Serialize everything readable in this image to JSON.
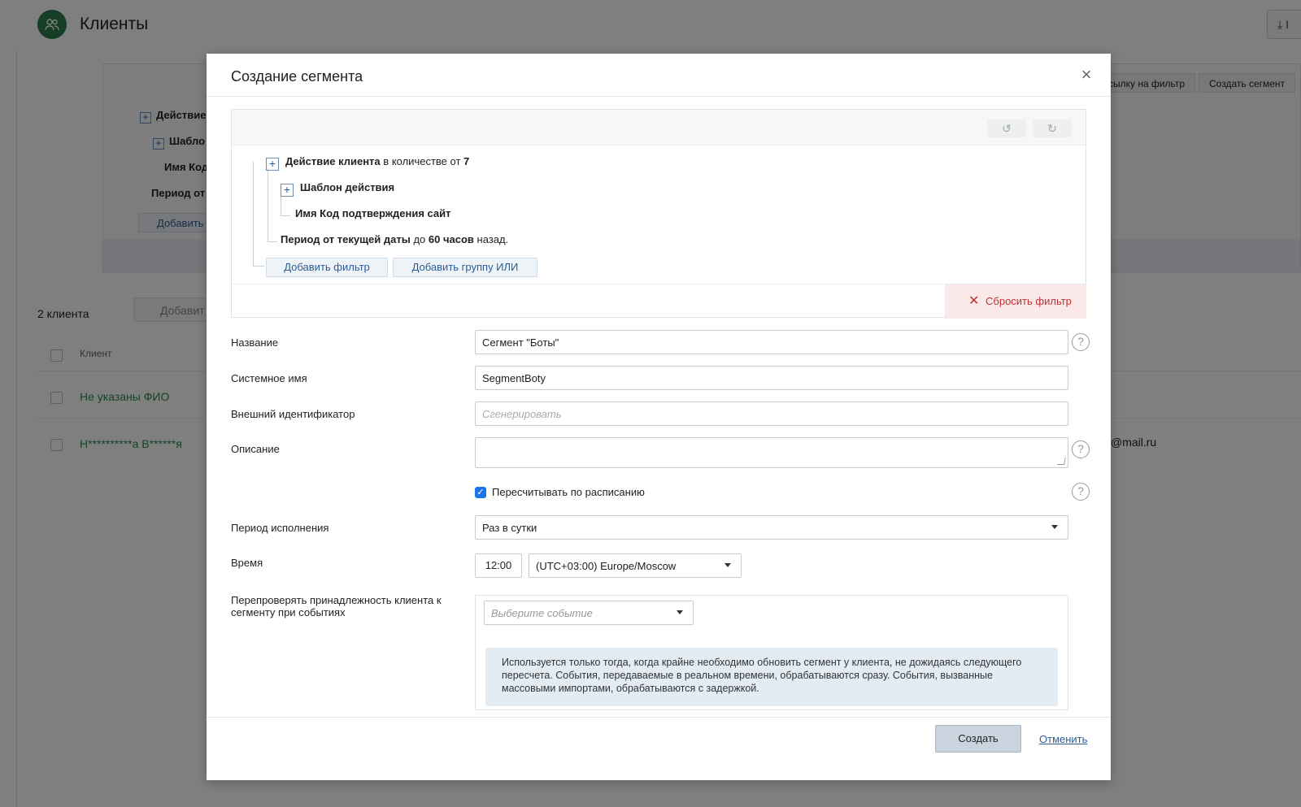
{
  "background": {
    "page_title": "Клиенты",
    "download_label": "⤓ I",
    "tree": {
      "action": "Действие",
      "template": "Шабло",
      "name": "Имя Код",
      "period": "Период от",
      "add_button": "Добавить"
    },
    "top_buttons": [
      "сылку на фильтр",
      "Создать сегмент"
    ],
    "client_count": "2 клиента",
    "add_small": "Добавит",
    "column_client": "Клиент",
    "rows": [
      {
        "name": "Не указаны ФИО"
      },
      {
        "name": "Н**********а В******я",
        "email": "@mail.ru"
      }
    ]
  },
  "modal": {
    "title": "Создание сегмента",
    "close_symbol": "×",
    "filter": {
      "undo_symbol": "↺",
      "redo_symbol": "↻",
      "action_bold": "Действие клиента",
      "action_rest": "в количестве от",
      "action_count": "7",
      "template_label": "Шаблон действия",
      "name_label": "Имя Код подтверждения сайт",
      "period_bold": "Период от текущей даты",
      "period_mid": "до",
      "period_value": "60 часов",
      "period_end": "назад.",
      "add_filter": "Добавить фильтр",
      "add_or_group": "Добавить группу ИЛИ",
      "reset_filter": "Сбросить фильтр",
      "reset_symbol": "✕"
    },
    "fields": {
      "name_label": "Название",
      "name_value": "Сегмент \"Боты\"",
      "system_name_label": "Системное имя",
      "system_name_value": "SegmentBoty",
      "external_id_label": "Внешний идентификатор",
      "external_id_placeholder": "Сгенерировать",
      "description_label": "Описание",
      "description_value": "",
      "recalc_label": "Пересчитывать по расписанию",
      "recalc_checked": true,
      "period_label": "Период исполнения",
      "period_value": "Раз в сутки",
      "time_label": "Время",
      "time_value": "12:00",
      "timezone_value": "(UTC+03:00) Europe/Moscow",
      "recheck_label_line1": "Перепроверять принадлежность клиента к",
      "recheck_label_line2": "сегменту при событиях",
      "event_placeholder": "Выберите событие",
      "info_text": "Используется только тогда, когда крайне необходимо обновить сегмент у клиента, не дожидаясь следующего пересчета. События, передаваемые в реальном времени, обрабатываются сразу. События, вызванные массовыми импортами, обрабатываются с задержкой."
    },
    "help_symbol": "?",
    "check_symbol": "✓",
    "create_button": "Создать",
    "cancel_link": "Отменить"
  },
  "colors": {
    "accent": "#2a5d93",
    "brand_green": "#2c7a4b",
    "reset_bg": "#fbe9e9",
    "reset_text": "#b33333",
    "checkbox": "#1a73e8"
  }
}
